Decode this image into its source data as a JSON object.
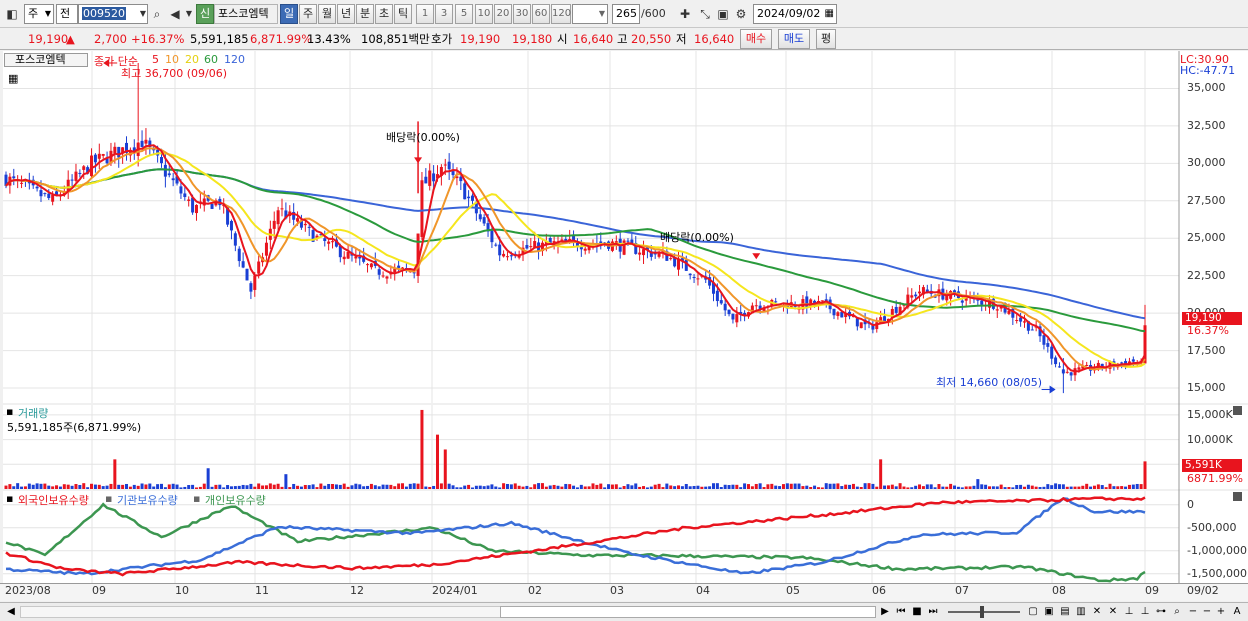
{
  "toolbar": {
    "market": "주",
    "category": "전",
    "code": "009520",
    "stock_badge": "신",
    "stock_name": "포스코엠텍",
    "periods": [
      "일",
      "주",
      "월",
      "년",
      "분",
      "초",
      "틱"
    ],
    "active_period": "일",
    "intervals": [
      "1",
      "3",
      "5",
      "10",
      "20",
      "30",
      "60",
      "120"
    ],
    "count": "265",
    "count_total": "/600",
    "date": "2024/09/02"
  },
  "quote": {
    "price": "19,190",
    "arrow": "▲",
    "change": "2,700",
    "change_pct": "+16.37%",
    "volume": "5,591,185",
    "volume_pct": "6,871.99%",
    "turnover": "13.43%",
    "amount": "108,851백만",
    "ask_label": "호가",
    "ask": "19,190",
    "bid": "19,180",
    "open_label": "시",
    "open": "16,640",
    "high_label": "고",
    "high": "20,550",
    "low_label": "저",
    "low": "16,640",
    "buy": "매수",
    "sell": "매도",
    "eval": "평"
  },
  "price_panel": {
    "tab": "포스코엠텍",
    "legend_prefix": "종가 단순",
    "legend_ma": [
      "5",
      "10",
      "20",
      "60",
      "120"
    ],
    "lc": "LC:30.90",
    "hc": "HC:-47.71",
    "max_label": "최고 36,700 (09/06)",
    "min_label": "최저 14,660 (08/05)",
    "div1": "배당락(0.00%)",
    "div2": "배당락(0.00%)",
    "last_price": "19,190",
    "last_pct": "16.37%",
    "y_ticks": [
      "35,000",
      "32,500",
      "30,000",
      "27,500",
      "25,000",
      "22,500",
      "20,000",
      "17,500",
      "15,000"
    ]
  },
  "volume_panel": {
    "title": "거래량",
    "value": "5,591,185주(6,871.99%)",
    "y_ticks": [
      "15,000K",
      "10,000K",
      "5,000K"
    ],
    "last_vol": "5,591K",
    "last_pct": "6871.99%"
  },
  "holding_panel": {
    "series": [
      "외국인보유수량",
      "기관보유수량",
      "개인보유수량"
    ],
    "y_ticks": [
      "0",
      "-500,000",
      "-1,000,000",
      "-1,500,000"
    ]
  },
  "x_axis": [
    "2023/08",
    "09",
    "10",
    "11",
    "12",
    "2024/01",
    "02",
    "03",
    "04",
    "05",
    "06",
    "07",
    "08",
    "09",
    "09/02"
  ],
  "colors": {
    "up": "#e8141e",
    "down": "#1a3fd4",
    "ma5": "#e8141e",
    "ma10": "#f0962a",
    "ma20": "#f5e61e",
    "ma60": "#2a9a3c",
    "ma120": "#3a64d8",
    "foreign": "#e8141e",
    "inst": "#3a6ed8",
    "indiv": "#3c9650"
  },
  "chart_data": {
    "type": "candlestick",
    "price_range": [
      14000,
      37500
    ],
    "anchors": [
      [
        0,
        29000
      ],
      [
        12,
        27500
      ],
      [
        22,
        30000
      ],
      [
        35,
        31500
      ],
      [
        48,
        27000
      ],
      [
        55,
        27500
      ],
      [
        63,
        21500
      ],
      [
        70,
        27000
      ],
      [
        80,
        25000
      ],
      [
        95,
        22800
      ],
      [
        105,
        22800
      ],
      [
        107,
        28500
      ],
      [
        112,
        29800
      ],
      [
        117,
        28500
      ],
      [
        127,
        24000
      ],
      [
        140,
        24600
      ],
      [
        155,
        24700
      ],
      [
        170,
        23800
      ],
      [
        180,
        22200
      ],
      [
        187,
        19400
      ],
      [
        192,
        20600
      ],
      [
        210,
        20600
      ],
      [
        222,
        19000
      ],
      [
        235,
        21500
      ],
      [
        255,
        20600
      ],
      [
        265,
        18800
      ],
      [
        272,
        16000
      ],
      [
        290,
        16800
      ],
      [
        292,
        16550
      ],
      [
        293,
        19190
      ]
    ],
    "volume_range_k": [
      0,
      17000
    ],
    "volume_spikes": [
      [
        28,
        6000
      ],
      [
        52,
        4200
      ],
      [
        72,
        3000
      ],
      [
        107,
        16000
      ],
      [
        111,
        11000
      ],
      [
        113,
        8000
      ],
      [
        225,
        6000
      ],
      [
        250,
        2000
      ],
      [
        293,
        5591
      ]
    ],
    "holding_range": [
      -1700000,
      300000
    ],
    "foreign": [
      [
        0,
        -1050000
      ],
      [
        15,
        -1400000
      ],
      [
        30,
        -1500000
      ],
      [
        60,
        -1250000
      ],
      [
        90,
        -1380000
      ],
      [
        110,
        -1300000
      ],
      [
        140,
        -950000
      ],
      [
        175,
        -500000
      ],
      [
        215,
        -180000
      ],
      [
        240,
        50000
      ],
      [
        260,
        80000
      ],
      [
        280,
        130000
      ],
      [
        293,
        130000
      ]
    ],
    "inst": [
      [
        0,
        -1400000
      ],
      [
        20,
        -1500000
      ],
      [
        50,
        -1200000
      ],
      [
        70,
        -480000
      ],
      [
        105,
        -620000
      ],
      [
        130,
        -400000
      ],
      [
        160,
        -1050000
      ],
      [
        190,
        -1500000
      ],
      [
        210,
        -1250000
      ],
      [
        235,
        -650000
      ],
      [
        260,
        -600000
      ],
      [
        272,
        150000
      ],
      [
        280,
        -150000
      ],
      [
        293,
        -150000
      ]
    ],
    "indiv": [
      [
        0,
        -800000
      ],
      [
        10,
        -1100000
      ],
      [
        25,
        0
      ],
      [
        40,
        -700000
      ],
      [
        58,
        -20000
      ],
      [
        75,
        -800000
      ],
      [
        110,
        -500000
      ],
      [
        125,
        -1000000
      ],
      [
        150,
        -1100000
      ],
      [
        165,
        -1100000
      ],
      [
        205,
        -1150000
      ],
      [
        230,
        -1400000
      ],
      [
        262,
        -1350000
      ],
      [
        282,
        -1650000
      ],
      [
        291,
        -1600000
      ],
      [
        293,
        -1450000
      ]
    ]
  }
}
